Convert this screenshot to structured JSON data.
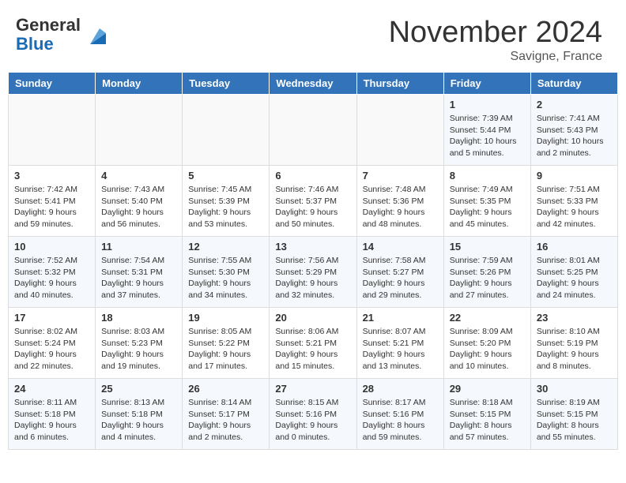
{
  "header": {
    "logo_general": "General",
    "logo_blue": "Blue",
    "title": "November 2024",
    "location": "Savigne, France"
  },
  "calendar": {
    "headers": [
      "Sunday",
      "Monday",
      "Tuesday",
      "Wednesday",
      "Thursday",
      "Friday",
      "Saturday"
    ],
    "rows": [
      [
        {
          "day": "",
          "info": ""
        },
        {
          "day": "",
          "info": ""
        },
        {
          "day": "",
          "info": ""
        },
        {
          "day": "",
          "info": ""
        },
        {
          "day": "",
          "info": ""
        },
        {
          "day": "1",
          "info": "Sunrise: 7:39 AM\nSunset: 5:44 PM\nDaylight: 10 hours\nand 5 minutes."
        },
        {
          "day": "2",
          "info": "Sunrise: 7:41 AM\nSunset: 5:43 PM\nDaylight: 10 hours\nand 2 minutes."
        }
      ],
      [
        {
          "day": "3",
          "info": "Sunrise: 7:42 AM\nSunset: 5:41 PM\nDaylight: 9 hours\nand 59 minutes."
        },
        {
          "day": "4",
          "info": "Sunrise: 7:43 AM\nSunset: 5:40 PM\nDaylight: 9 hours\nand 56 minutes."
        },
        {
          "day": "5",
          "info": "Sunrise: 7:45 AM\nSunset: 5:39 PM\nDaylight: 9 hours\nand 53 minutes."
        },
        {
          "day": "6",
          "info": "Sunrise: 7:46 AM\nSunset: 5:37 PM\nDaylight: 9 hours\nand 50 minutes."
        },
        {
          "day": "7",
          "info": "Sunrise: 7:48 AM\nSunset: 5:36 PM\nDaylight: 9 hours\nand 48 minutes."
        },
        {
          "day": "8",
          "info": "Sunrise: 7:49 AM\nSunset: 5:35 PM\nDaylight: 9 hours\nand 45 minutes."
        },
        {
          "day": "9",
          "info": "Sunrise: 7:51 AM\nSunset: 5:33 PM\nDaylight: 9 hours\nand 42 minutes."
        }
      ],
      [
        {
          "day": "10",
          "info": "Sunrise: 7:52 AM\nSunset: 5:32 PM\nDaylight: 9 hours\nand 40 minutes."
        },
        {
          "day": "11",
          "info": "Sunrise: 7:54 AM\nSunset: 5:31 PM\nDaylight: 9 hours\nand 37 minutes."
        },
        {
          "day": "12",
          "info": "Sunrise: 7:55 AM\nSunset: 5:30 PM\nDaylight: 9 hours\nand 34 minutes."
        },
        {
          "day": "13",
          "info": "Sunrise: 7:56 AM\nSunset: 5:29 PM\nDaylight: 9 hours\nand 32 minutes."
        },
        {
          "day": "14",
          "info": "Sunrise: 7:58 AM\nSunset: 5:27 PM\nDaylight: 9 hours\nand 29 minutes."
        },
        {
          "day": "15",
          "info": "Sunrise: 7:59 AM\nSunset: 5:26 PM\nDaylight: 9 hours\nand 27 minutes."
        },
        {
          "day": "16",
          "info": "Sunrise: 8:01 AM\nSunset: 5:25 PM\nDaylight: 9 hours\nand 24 minutes."
        }
      ],
      [
        {
          "day": "17",
          "info": "Sunrise: 8:02 AM\nSunset: 5:24 PM\nDaylight: 9 hours\nand 22 minutes."
        },
        {
          "day": "18",
          "info": "Sunrise: 8:03 AM\nSunset: 5:23 PM\nDaylight: 9 hours\nand 19 minutes."
        },
        {
          "day": "19",
          "info": "Sunrise: 8:05 AM\nSunset: 5:22 PM\nDaylight: 9 hours\nand 17 minutes."
        },
        {
          "day": "20",
          "info": "Sunrise: 8:06 AM\nSunset: 5:21 PM\nDaylight: 9 hours\nand 15 minutes."
        },
        {
          "day": "21",
          "info": "Sunrise: 8:07 AM\nSunset: 5:21 PM\nDaylight: 9 hours\nand 13 minutes."
        },
        {
          "day": "22",
          "info": "Sunrise: 8:09 AM\nSunset: 5:20 PM\nDaylight: 9 hours\nand 10 minutes."
        },
        {
          "day": "23",
          "info": "Sunrise: 8:10 AM\nSunset: 5:19 PM\nDaylight: 9 hours\nand 8 minutes."
        }
      ],
      [
        {
          "day": "24",
          "info": "Sunrise: 8:11 AM\nSunset: 5:18 PM\nDaylight: 9 hours\nand 6 minutes."
        },
        {
          "day": "25",
          "info": "Sunrise: 8:13 AM\nSunset: 5:18 PM\nDaylight: 9 hours\nand 4 minutes."
        },
        {
          "day": "26",
          "info": "Sunrise: 8:14 AM\nSunset: 5:17 PM\nDaylight: 9 hours\nand 2 minutes."
        },
        {
          "day": "27",
          "info": "Sunrise: 8:15 AM\nSunset: 5:16 PM\nDaylight: 9 hours\nand 0 minutes."
        },
        {
          "day": "28",
          "info": "Sunrise: 8:17 AM\nSunset: 5:16 PM\nDaylight: 8 hours\nand 59 minutes."
        },
        {
          "day": "29",
          "info": "Sunrise: 8:18 AM\nSunset: 5:15 PM\nDaylight: 8 hours\nand 57 minutes."
        },
        {
          "day": "30",
          "info": "Sunrise: 8:19 AM\nSunset: 5:15 PM\nDaylight: 8 hours\nand 55 minutes."
        }
      ]
    ]
  }
}
